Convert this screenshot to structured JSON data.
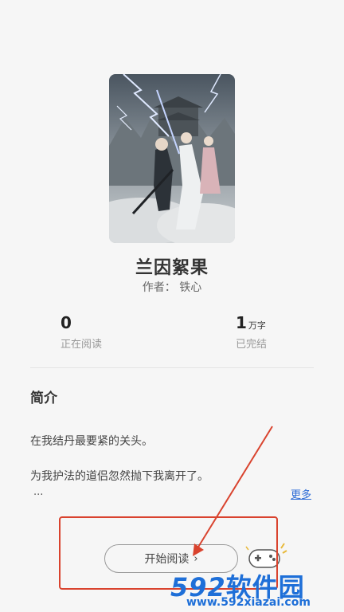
{
  "book": {
    "title": "兰因絮果",
    "author_prefix": "作者：",
    "author_name": "铁心"
  },
  "stats": {
    "reading_value": "0",
    "reading_label": "正在阅读",
    "words_value": "1",
    "words_unit": "万字",
    "words_label": "已完结"
  },
  "intro": {
    "heading": "简介",
    "paragraphs": [
      "在我结丹最要紧的关头。",
      "为我护法的道侣忽然抛下我离开了。"
    ],
    "ellipsis": "...",
    "more": "更多"
  },
  "actions": {
    "start_reading": "开始阅读",
    "start_chevron": "›"
  },
  "watermark": {
    "logo_number": "592",
    "logo_text": "软件园",
    "url": "www.592xiazai.com"
  },
  "colors": {
    "annotation_red": "#d9432e",
    "watermark_blue": "#1e6fd8",
    "link_blue": "#2c6bd6"
  }
}
